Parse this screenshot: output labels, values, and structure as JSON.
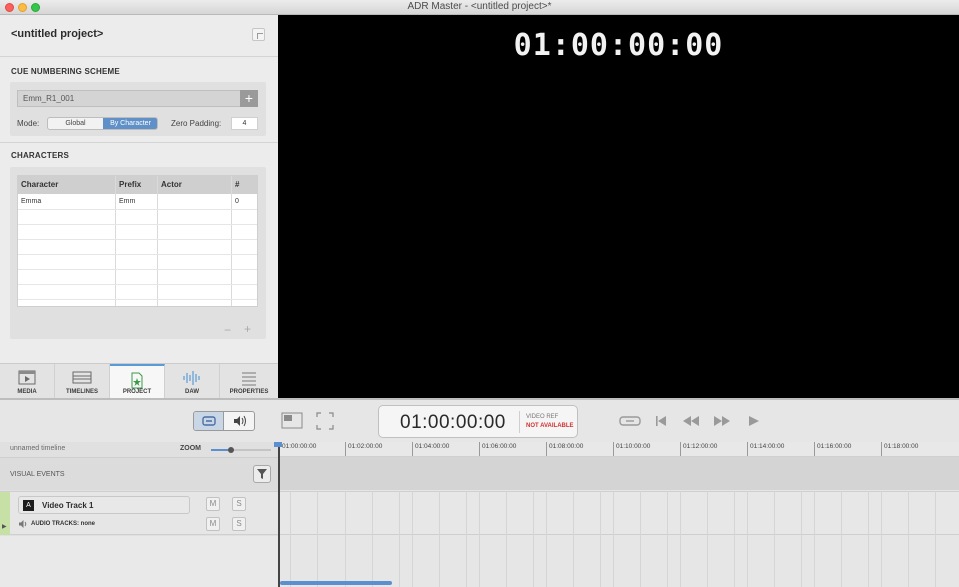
{
  "window": {
    "title": "ADR Master - <untitled project>*"
  },
  "project": {
    "title": "<untitled project>"
  },
  "cue_numbering": {
    "heading": "CUE NUMBERING SCHEME",
    "scheme_value": "Emm_R1_001",
    "add_label": "+",
    "mode_label": "Mode:",
    "mode_options": [
      "Global",
      "By Character"
    ],
    "mode_selected": "By Character",
    "zero_padding_label": "Zero Padding:",
    "zero_padding_value": "4"
  },
  "characters": {
    "heading": "CHARACTERS",
    "columns": [
      "Character",
      "Prefix",
      "Actor",
      "#"
    ],
    "rows": [
      {
        "character": "Emma",
        "prefix": "Emm",
        "actor": "",
        "count": "0"
      }
    ],
    "remove_label": "−",
    "add_label": "+"
  },
  "tabs": [
    {
      "label": "MEDIA",
      "icon": "film-icon"
    },
    {
      "label": "TIMELINES",
      "icon": "timeline-icon"
    },
    {
      "label": "PROJECT",
      "icon": "project-doc-icon",
      "active": true
    },
    {
      "label": "DAW",
      "icon": "waveform-icon"
    },
    {
      "label": "PROPERTIES",
      "icon": "properties-list-icon"
    }
  ],
  "video": {
    "timecode_overlay": "01:00:00:00"
  },
  "transport": {
    "timecode": "01:00:00:00",
    "video_ref_label": "VIDEO REF",
    "video_ref_status": "NOT AVAILABLE",
    "status_color": "#d03030"
  },
  "timeline": {
    "name": "unnamed timeline",
    "zoom_label": "ZOOM",
    "visual_events_label": "VISUAL EVENTS",
    "ruler_labels": [
      "01:00:00:00",
      "01:02:00:00",
      "01:04:00:00",
      "01:06:00:00",
      "01:08:00:00",
      "01:10:00:00",
      "01:12:00:00",
      "01:14:00:00",
      "01:16:00:00",
      "01:18:00:00"
    ],
    "tracks": [
      {
        "name": "Video Track 1",
        "audio_tracks_label": "AUDIO TRACKS: none",
        "mute_label": "M",
        "solo_label": "S"
      }
    ]
  },
  "colors": {
    "accent": "#5b8fd0",
    "track": "#c7e0a6"
  }
}
